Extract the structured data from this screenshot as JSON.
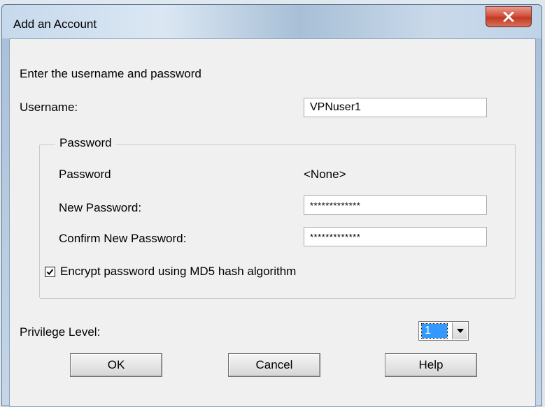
{
  "window": {
    "title": "Add an Account",
    "close_icon": "close-x-icon"
  },
  "form": {
    "instruction": "Enter the username and password",
    "username_label": "Username:",
    "username_value": "VPNuser1",
    "password_group": {
      "legend": "Password",
      "current_password_label": "Password",
      "current_password_value": "<None>",
      "new_password_label": "New Password:",
      "new_password_value": "*************",
      "confirm_password_label": "Confirm New Password:",
      "confirm_password_value": "*************",
      "encrypt_checkbox_label": "Encrypt password using MD5 hash algorithm",
      "encrypt_checked": true
    },
    "privilege_label": "Privilege Level:",
    "privilege_value": "1"
  },
  "buttons": {
    "ok": "OK",
    "cancel": "Cancel",
    "help": "Help"
  },
  "colors": {
    "dialog_background": "#f0f0f0",
    "selection_highlight": "#3399ff",
    "close_button_red": "#c03a22"
  }
}
